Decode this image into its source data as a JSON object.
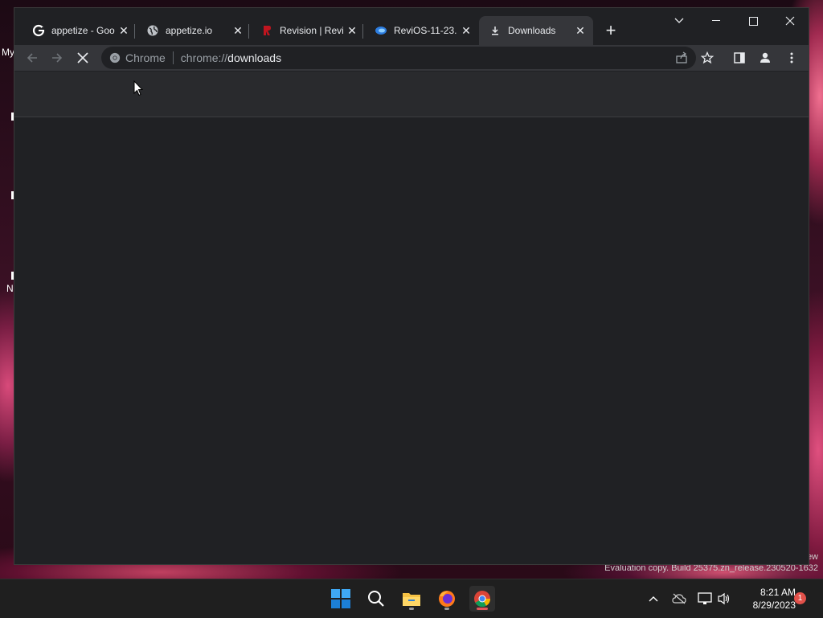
{
  "desktop": {
    "labels": [
      "My",
      "N"
    ],
    "watermark": "Evaluation copy. Build 25375.zn_release.230520-1632",
    "watermark_tail": "ew"
  },
  "browser": {
    "tabs": [
      {
        "title": "appetize - Goo",
        "icon": "google-icon",
        "active": false
      },
      {
        "title": "appetize.io",
        "icon": "globe-icon",
        "active": false
      },
      {
        "title": "Revision | Revi",
        "icon": "revision-icon",
        "active": false
      },
      {
        "title": "ReviOS-11-23.",
        "icon": "edge-icon",
        "active": false
      },
      {
        "title": "Downloads",
        "icon": "download-icon",
        "active": true
      }
    ],
    "omnibox": {
      "site_label": "Chrome",
      "url_scheme": "chrome://",
      "url_path": "downloads"
    }
  },
  "taskbar": {
    "apps": [
      "start",
      "search",
      "file-explorer",
      "firefox",
      "chrome"
    ],
    "clock_time": "8:21 AM",
    "clock_date": "8/29/2023",
    "notification_count": "1"
  },
  "colors": {
    "window_bg": "#202124",
    "toolbar_bg": "#35363a",
    "accent": "#8ab4f8"
  }
}
